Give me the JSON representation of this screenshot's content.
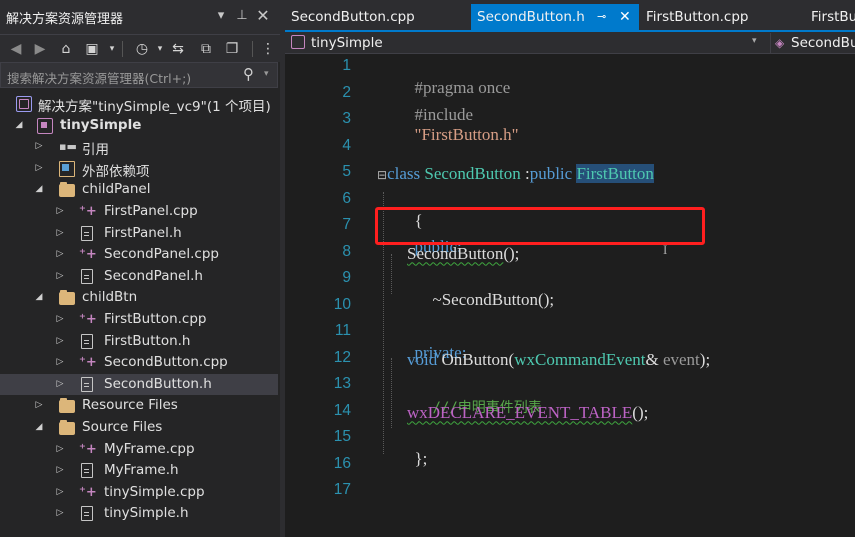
{
  "solution_explorer": {
    "title": "解决方案资源管理器",
    "search_placeholder": "搜索解决方案资源管理器(Ctrl+;)",
    "tree": [
      {
        "label": "解决方案\"tinySimple_vc9\"(1 个项目)",
        "icon": "solution-icon"
      },
      {
        "label": "tinySimple",
        "icon": "cpp-project-icon"
      },
      {
        "label": "引用",
        "icon": "references-icon"
      },
      {
        "label": "外部依赖项",
        "icon": "external-dependencies-icon"
      },
      {
        "label": "childPanel",
        "icon": "filter-folder-icon"
      },
      {
        "label": "FirstPanel.cpp",
        "icon": "cpp-file-icon"
      },
      {
        "label": "FirstPanel.h",
        "icon": "header-file-icon"
      },
      {
        "label": "SecondPanel.cpp",
        "icon": "cpp-file-icon"
      },
      {
        "label": "SecondPanel.h",
        "icon": "header-file-icon"
      },
      {
        "label": "childBtn",
        "icon": "filter-folder-icon"
      },
      {
        "label": "FirstButton.cpp",
        "icon": "cpp-file-icon"
      },
      {
        "label": "FirstButton.h",
        "icon": "header-file-icon"
      },
      {
        "label": "SecondButton.cpp",
        "icon": "cpp-file-icon"
      },
      {
        "label": "SecondButton.h",
        "icon": "header-file-icon"
      },
      {
        "label": "Resource Files",
        "icon": "filter-folder-icon"
      },
      {
        "label": "Source Files",
        "icon": "filter-folder-icon"
      },
      {
        "label": "MyFrame.cpp",
        "icon": "cpp-file-icon"
      },
      {
        "label": "MyFrame.h",
        "icon": "header-file-icon"
      },
      {
        "label": "tinySimple.cpp",
        "icon": "cpp-file-icon"
      },
      {
        "label": "tinySimple.h",
        "icon": "header-file-icon"
      }
    ],
    "selected_item": "SecondButton.h"
  },
  "editor": {
    "tabs": [
      {
        "label": "SecondButton.cpp",
        "active": false
      },
      {
        "label": "SecondButton.h",
        "active": true
      },
      {
        "label": "FirstButton.cpp",
        "active": false
      },
      {
        "label": "FirstBu",
        "active": false
      }
    ],
    "nav_project": "tinySimple",
    "nav_scope": "SecondBu",
    "line_numbers": [
      "1",
      "2",
      "3",
      "4",
      "5",
      "6",
      "7",
      "8",
      "9",
      "10",
      "11",
      "12",
      "13",
      "14",
      "15",
      "16",
      "17"
    ],
    "code": {
      "l1": {
        "directive": "#pragma once"
      },
      "l2": {
        "directive": "#include",
        "path": "\"FirstButton.h\""
      },
      "l5": {
        "kw_class": "class",
        "name": "SecondButton",
        "colon": " :",
        "kw_public": "public",
        "base": "FirstButton"
      },
      "l6": {
        "text": "{"
      },
      "l7": {
        "text": "public:"
      },
      "l8": {
        "name": "SecondButton",
        "rest": "();"
      },
      "l9": {
        "text": "~SecondButton();"
      },
      "l11": {
        "text": "private:"
      },
      "l12": {
        "kw": "void",
        "fn": "OnButton(",
        "type": "wxCommandEvent",
        "amp": "& ",
        "param": "event",
        "end": ");"
      },
      "l13": {
        "comment": "///申明事件列表"
      },
      "l14": {
        "macro": "wxDECLARE_EVENT_TABLE",
        "end": "();"
      },
      "l15": {
        "text": "};"
      }
    }
  },
  "colors": {
    "accent": "#007acc",
    "highlight_box": "#ff1f1f",
    "selection": "#264f78"
  }
}
